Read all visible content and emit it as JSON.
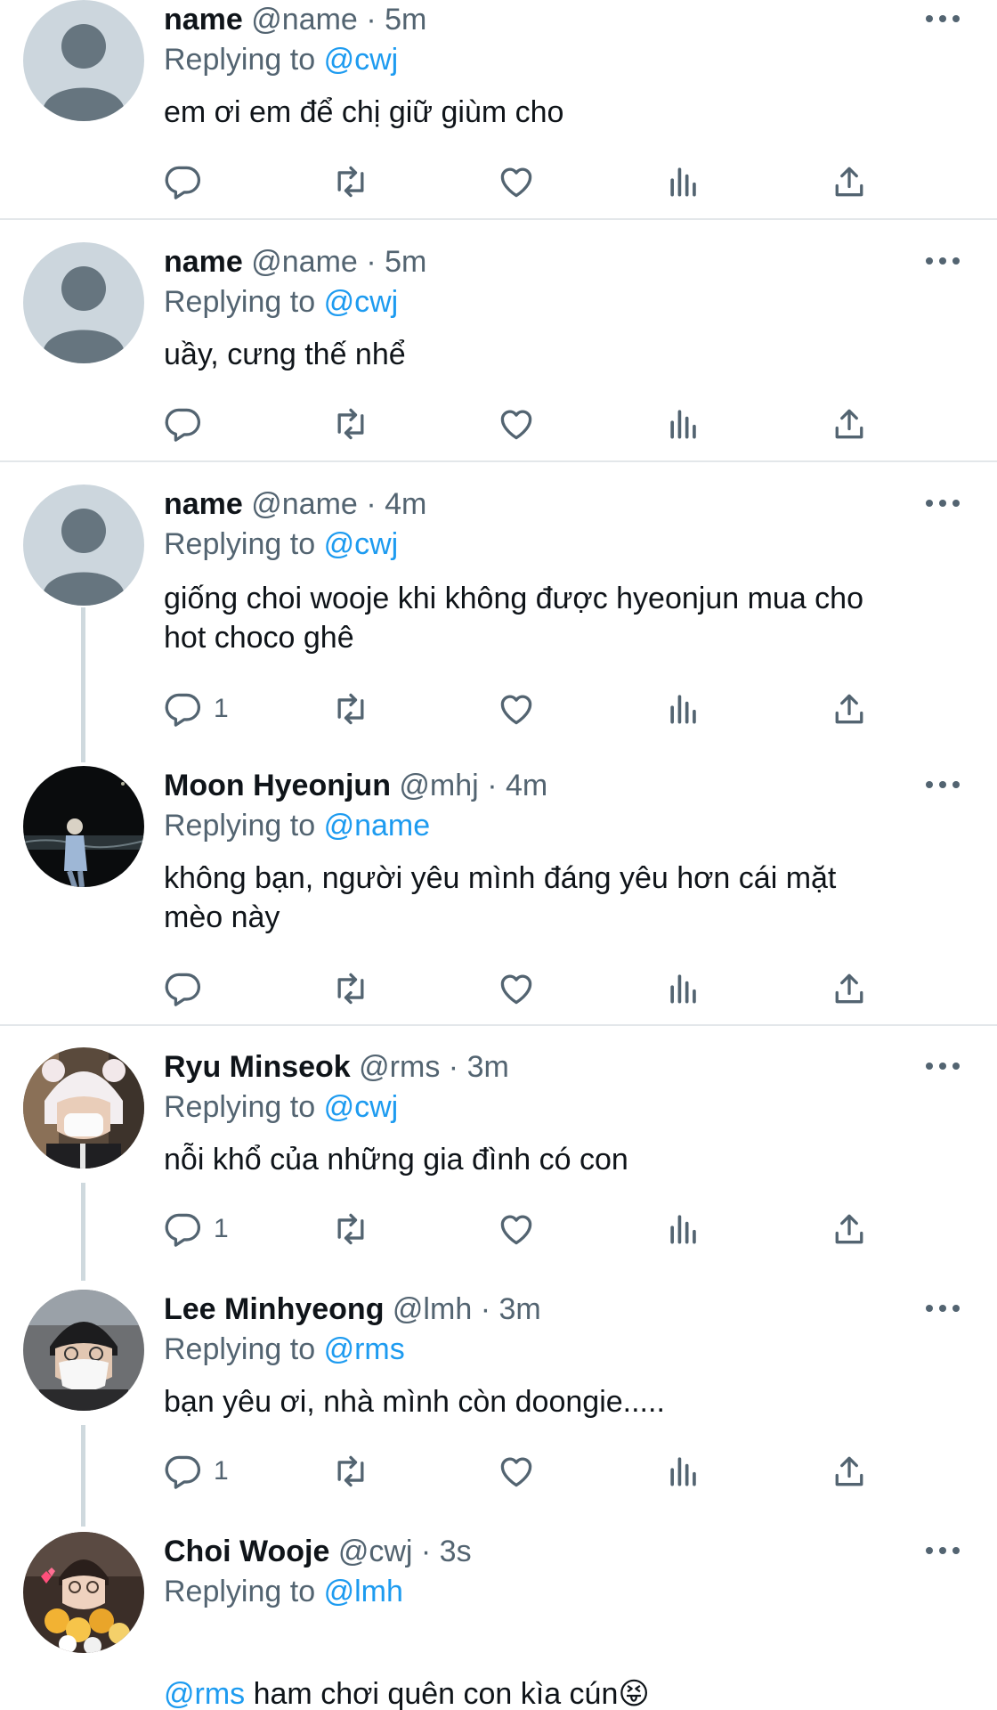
{
  "tweets": [
    {
      "display_name": "name",
      "handle": "@name",
      "separator": "·",
      "time": "5m",
      "replying_prefix": "Replying to",
      "replying_to": "@cwj",
      "text": "em ơi em để chị giữ giùm cho",
      "reply_count": "",
      "avatar": "default-avatar"
    },
    {
      "display_name": "name",
      "handle": "@name",
      "separator": "·",
      "time": "5m",
      "replying_prefix": "Replying to",
      "replying_to": "@cwj",
      "text": "uầy, cưng thế nhể",
      "reply_count": "",
      "avatar": "default-avatar"
    },
    {
      "display_name": "name",
      "handle": "@name",
      "separator": "·",
      "time": "4m",
      "replying_prefix": "Replying to",
      "replying_to": "@cwj",
      "text": "giống choi wooje khi không được hyeonjun mua cho\nhot choco ghê",
      "reply_count": "1",
      "avatar": "default-avatar"
    },
    {
      "display_name": "Moon Hyeonjun",
      "handle": "@mhj",
      "separator": "·",
      "time": "4m",
      "replying_prefix": "Replying to",
      "replying_to": "@name",
      "text": "không bạn, người yêu mình đáng yêu hơn cái mặt\nmèo này",
      "reply_count": "",
      "avatar": "night-beach-photo"
    },
    {
      "display_name": "Ryu Minseok",
      "handle": "@rms",
      "separator": "·",
      "time": "3m",
      "replying_prefix": "Replying to",
      "replying_to": "@cwj",
      "text": "nỗi khổ của những gia đình có con",
      "reply_count": "1",
      "avatar": "panda-hat-photo"
    },
    {
      "display_name": "Lee Minhyeong",
      "handle": "@lmh",
      "separator": "·",
      "time": "3m",
      "replying_prefix": "Replying to",
      "replying_to": "@rms",
      "text": "bạn yêu ơi, nhà mình còn doongie.....",
      "reply_count": "1",
      "avatar": "mask-photo"
    },
    {
      "display_name": "Choi Wooje",
      "handle": "@cwj",
      "separator": "·",
      "time": "3s",
      "replying_prefix": "Replying to",
      "replying_to": "@lmh",
      "text_mention": "@rms",
      "text": " ham chơi quên con kìa cún😝",
      "reply_count": "",
      "avatar": "flowers-photo"
    }
  ],
  "icons": {
    "reply": "reply-icon",
    "retweet": "retweet-icon",
    "like": "like-icon",
    "views": "views-icon",
    "share": "share-icon",
    "more": "more-icon"
  },
  "colors": {
    "text": "#0f1419",
    "secondary": "#536471",
    "link": "#1d9bf0",
    "divider": "#e3e7ea",
    "thread_line": "#cfd9de",
    "default_avatar_bg": "#ccd6dd",
    "default_avatar_fg": "#66757f"
  }
}
